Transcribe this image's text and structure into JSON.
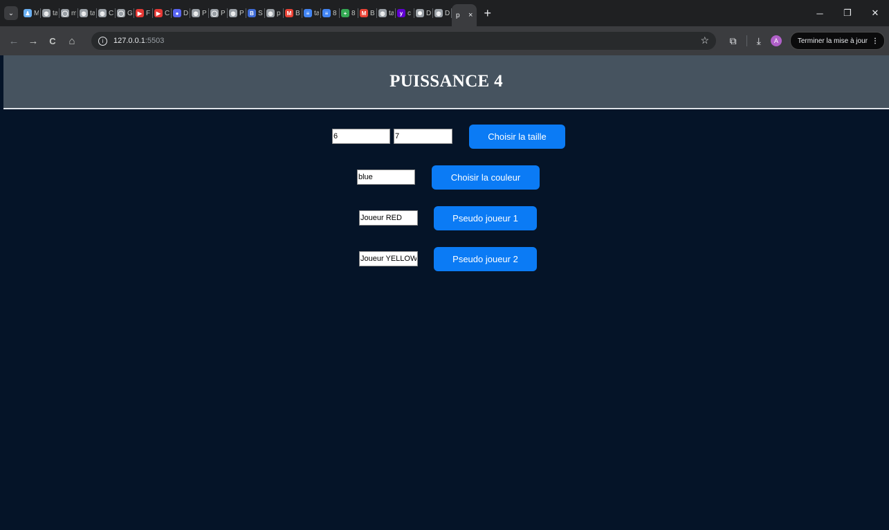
{
  "browser": {
    "tabs": [
      {
        "letter": "M",
        "icon": "person-icon",
        "color": "#6ab0f3"
      },
      {
        "letter": "ta",
        "icon": "globe-icon",
        "color": "#9aa0a6"
      },
      {
        "letter": "m",
        "icon": "github-icon",
        "color": "#9aa0a6"
      },
      {
        "letter": "ta",
        "icon": "globe-icon",
        "color": "#9aa0a6"
      },
      {
        "letter": "C",
        "icon": "globe-icon",
        "color": "#9aa0a6"
      },
      {
        "letter": "G",
        "icon": "github-icon",
        "color": "#9aa0a6"
      },
      {
        "letter": "F",
        "icon": "youtube-icon",
        "color": "#e53935"
      },
      {
        "letter": "C",
        "icon": "youtube-icon",
        "color": "#e53935"
      },
      {
        "letter": "D",
        "icon": "discord-icon",
        "color": "#5865f2"
      },
      {
        "letter": "P",
        "icon": "globe-icon",
        "color": "#9aa0a6"
      },
      {
        "letter": "P",
        "icon": "github-icon",
        "color": "#9aa0a6"
      },
      {
        "letter": "P",
        "icon": "globe-icon",
        "color": "#9aa0a6"
      },
      {
        "letter": "S",
        "icon": "bts-icon",
        "color": "#3f6bd6"
      },
      {
        "letter": "p",
        "icon": "globe-icon",
        "color": "#9aa0a6"
      },
      {
        "letter": "B",
        "icon": "gmail-icon",
        "color": "#e94235"
      },
      {
        "letter": "ta",
        "icon": "docs-icon",
        "color": "#4285f4"
      },
      {
        "letter": "8",
        "icon": "docs-icon",
        "color": "#4285f4"
      },
      {
        "letter": "8",
        "icon": "sheets-icon",
        "color": "#34a853"
      },
      {
        "letter": "B",
        "icon": "gmail-icon",
        "color": "#e94235"
      },
      {
        "letter": "ta",
        "icon": "globe-icon",
        "color": "#9aa0a6"
      },
      {
        "letter": "c",
        "icon": "yahoo-icon",
        "color": "#6001d2"
      },
      {
        "letter": "D",
        "icon": "openai-icon",
        "color": "#9aa0a6"
      },
      {
        "letter": "D",
        "icon": "globe-icon",
        "color": "#9aa0a6"
      }
    ],
    "active_tab": {
      "letter": "p",
      "close": "×"
    },
    "new_tab": "+",
    "window_controls": {
      "minimize": "─",
      "restore": "❐",
      "close": "✕"
    },
    "nav": {
      "back": "←",
      "forward": "→",
      "reload": "C",
      "home": "⌂"
    },
    "url_host": "127.0.0.1",
    "url_port": ":5503",
    "update_label": "Terminer la mise à jour",
    "avatar_letter": "A"
  },
  "page": {
    "title": "PUISSANCE 4",
    "size": {
      "rows_value": "6",
      "cols_value": "7",
      "button": "Choisir la taille"
    },
    "color": {
      "value": "blue",
      "button": "Choisir la couleur"
    },
    "player1": {
      "value": "Joueur RED",
      "button": "Pseudo joueur 1"
    },
    "player2": {
      "value": "Joueur YELLOW",
      "button": "Pseudo joueur 2"
    },
    "colors": {
      "background": "#051428",
      "header": "#46535f",
      "button": "#0b7bf5"
    }
  }
}
